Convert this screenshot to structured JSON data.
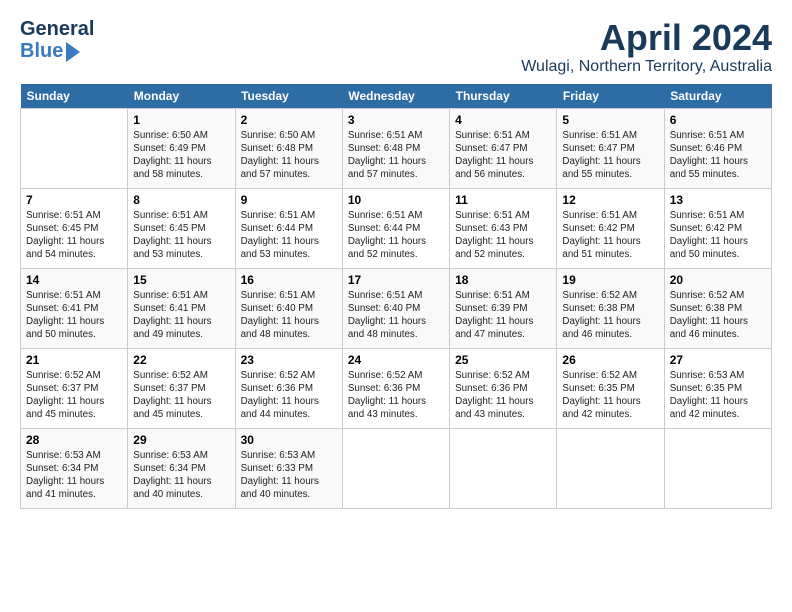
{
  "header": {
    "logo_line1": "General",
    "logo_line2": "Blue",
    "month": "April 2024",
    "location": "Wulagi, Northern Territory, Australia"
  },
  "weekdays": [
    "Sunday",
    "Monday",
    "Tuesday",
    "Wednesday",
    "Thursday",
    "Friday",
    "Saturday"
  ],
  "weeks": [
    [
      {
        "day": "",
        "info": ""
      },
      {
        "day": "1",
        "info": "Sunrise: 6:50 AM\nSunset: 6:49 PM\nDaylight: 11 hours\nand 58 minutes."
      },
      {
        "day": "2",
        "info": "Sunrise: 6:50 AM\nSunset: 6:48 PM\nDaylight: 11 hours\nand 57 minutes."
      },
      {
        "day": "3",
        "info": "Sunrise: 6:51 AM\nSunset: 6:48 PM\nDaylight: 11 hours\nand 57 minutes."
      },
      {
        "day": "4",
        "info": "Sunrise: 6:51 AM\nSunset: 6:47 PM\nDaylight: 11 hours\nand 56 minutes."
      },
      {
        "day": "5",
        "info": "Sunrise: 6:51 AM\nSunset: 6:47 PM\nDaylight: 11 hours\nand 55 minutes."
      },
      {
        "day": "6",
        "info": "Sunrise: 6:51 AM\nSunset: 6:46 PM\nDaylight: 11 hours\nand 55 minutes."
      }
    ],
    [
      {
        "day": "7",
        "info": "Sunrise: 6:51 AM\nSunset: 6:45 PM\nDaylight: 11 hours\nand 54 minutes."
      },
      {
        "day": "8",
        "info": "Sunrise: 6:51 AM\nSunset: 6:45 PM\nDaylight: 11 hours\nand 53 minutes."
      },
      {
        "day": "9",
        "info": "Sunrise: 6:51 AM\nSunset: 6:44 PM\nDaylight: 11 hours\nand 53 minutes."
      },
      {
        "day": "10",
        "info": "Sunrise: 6:51 AM\nSunset: 6:44 PM\nDaylight: 11 hours\nand 52 minutes."
      },
      {
        "day": "11",
        "info": "Sunrise: 6:51 AM\nSunset: 6:43 PM\nDaylight: 11 hours\nand 52 minutes."
      },
      {
        "day": "12",
        "info": "Sunrise: 6:51 AM\nSunset: 6:42 PM\nDaylight: 11 hours\nand 51 minutes."
      },
      {
        "day": "13",
        "info": "Sunrise: 6:51 AM\nSunset: 6:42 PM\nDaylight: 11 hours\nand 50 minutes."
      }
    ],
    [
      {
        "day": "14",
        "info": "Sunrise: 6:51 AM\nSunset: 6:41 PM\nDaylight: 11 hours\nand 50 minutes."
      },
      {
        "day": "15",
        "info": "Sunrise: 6:51 AM\nSunset: 6:41 PM\nDaylight: 11 hours\nand 49 minutes."
      },
      {
        "day": "16",
        "info": "Sunrise: 6:51 AM\nSunset: 6:40 PM\nDaylight: 11 hours\nand 48 minutes."
      },
      {
        "day": "17",
        "info": "Sunrise: 6:51 AM\nSunset: 6:40 PM\nDaylight: 11 hours\nand 48 minutes."
      },
      {
        "day": "18",
        "info": "Sunrise: 6:51 AM\nSunset: 6:39 PM\nDaylight: 11 hours\nand 47 minutes."
      },
      {
        "day": "19",
        "info": "Sunrise: 6:52 AM\nSunset: 6:38 PM\nDaylight: 11 hours\nand 46 minutes."
      },
      {
        "day": "20",
        "info": "Sunrise: 6:52 AM\nSunset: 6:38 PM\nDaylight: 11 hours\nand 46 minutes."
      }
    ],
    [
      {
        "day": "21",
        "info": "Sunrise: 6:52 AM\nSunset: 6:37 PM\nDaylight: 11 hours\nand 45 minutes."
      },
      {
        "day": "22",
        "info": "Sunrise: 6:52 AM\nSunset: 6:37 PM\nDaylight: 11 hours\nand 45 minutes."
      },
      {
        "day": "23",
        "info": "Sunrise: 6:52 AM\nSunset: 6:36 PM\nDaylight: 11 hours\nand 44 minutes."
      },
      {
        "day": "24",
        "info": "Sunrise: 6:52 AM\nSunset: 6:36 PM\nDaylight: 11 hours\nand 43 minutes."
      },
      {
        "day": "25",
        "info": "Sunrise: 6:52 AM\nSunset: 6:36 PM\nDaylight: 11 hours\nand 43 minutes."
      },
      {
        "day": "26",
        "info": "Sunrise: 6:52 AM\nSunset: 6:35 PM\nDaylight: 11 hours\nand 42 minutes."
      },
      {
        "day": "27",
        "info": "Sunrise: 6:53 AM\nSunset: 6:35 PM\nDaylight: 11 hours\nand 42 minutes."
      }
    ],
    [
      {
        "day": "28",
        "info": "Sunrise: 6:53 AM\nSunset: 6:34 PM\nDaylight: 11 hours\nand 41 minutes."
      },
      {
        "day": "29",
        "info": "Sunrise: 6:53 AM\nSunset: 6:34 PM\nDaylight: 11 hours\nand 40 minutes."
      },
      {
        "day": "30",
        "info": "Sunrise: 6:53 AM\nSunset: 6:33 PM\nDaylight: 11 hours\nand 40 minutes."
      },
      {
        "day": "",
        "info": ""
      },
      {
        "day": "",
        "info": ""
      },
      {
        "day": "",
        "info": ""
      },
      {
        "day": "",
        "info": ""
      }
    ]
  ]
}
